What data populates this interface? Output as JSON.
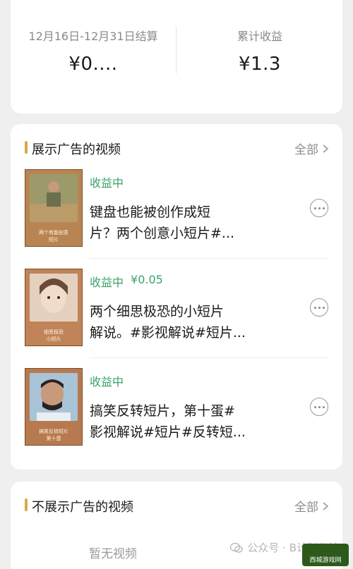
{
  "summary": {
    "period_label": "12月16日-12月31日结算",
    "period_value": "¥0....",
    "total_label": "累计收益",
    "total_value": "¥1.3"
  },
  "ad_videos": {
    "title": "展示广告的视频",
    "all_label": "全部",
    "items": [
      {
        "status": "收益中",
        "amount": "",
        "title_line1": "键盘也能被创作成短",
        "title_line2": "片？两个创意小短片#...",
        "thumb_caption1": "两个有能创意",
        "thumb_caption2": "短片"
      },
      {
        "status": "收益中",
        "amount": "¥0.05",
        "title_line1": "两个细思极恐的小短片",
        "title_line2": "解说。#影视解说#短片...",
        "thumb_caption1": "细思极恐",
        "thumb_caption2": "小短片"
      },
      {
        "status": "收益中",
        "amount": "",
        "title_line1": "搞笑反转短片，第十蛋#",
        "title_line2": "影视解说#短片#反转短...",
        "thumb_caption1": "搞笑反转短片",
        "thumb_caption2": "第十蛋"
      }
    ]
  },
  "no_ad_videos": {
    "title": "不展示广告的视频",
    "all_label": "全部",
    "empty_text": "暂无视频"
  },
  "watermark": {
    "text": "公众号 · B计划公社",
    "badge_text": "西城游戏网"
  },
  "colors": {
    "status_green": "#39a467",
    "accent_bar": "#d8a94a",
    "background": "#efefef"
  }
}
